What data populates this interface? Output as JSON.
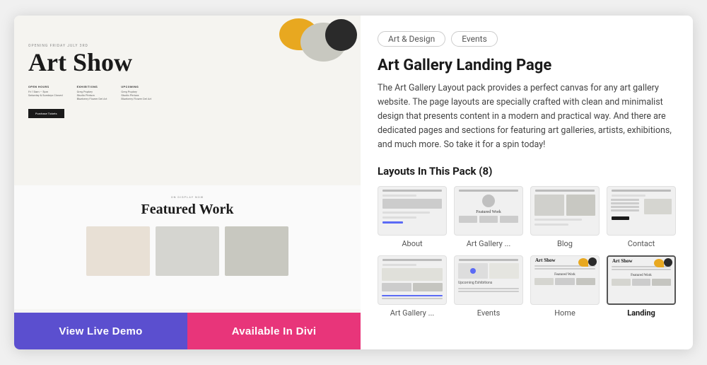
{
  "tags": [
    {
      "label": "Art & Design"
    },
    {
      "label": "Events"
    }
  ],
  "product": {
    "title": "Art Gallery Landing Page",
    "description": "The Art Gallery Layout pack provides a perfect canvas for any art gallery website. The page layouts are specially crafted with clean and minimalist design that presents content in a modern and practical way. And there are dedicated pages and sections for featuring art galleries, artists, exhibitions, and much more. So take it for a spin today!",
    "layouts_heading": "Layouts In This Pack (8)"
  },
  "preview": {
    "small_text": "Opening Friday July 3rd",
    "title": "Art Show",
    "info_cols": [
      {
        "label": "Open Hours",
        "value": "Fri 10am – 5pm\nSaturday & Sundays Closed"
      },
      {
        "label": "Exhibitions",
        "value": "Greg Popkey\nStudio Pintura\nBlueberry Flower Del Art"
      },
      {
        "label": "Upcoming",
        "value": "Greg Popkey\nStudio Pintura\nBlueberry Flower Del Art"
      }
    ],
    "button": "Purchase Tickets",
    "on_display": "On Display Now",
    "featured_title": "Featured Work"
  },
  "actions": {
    "demo_label": "View Live Demo",
    "divi_label": "Available In Divi"
  },
  "layouts": [
    {
      "label": "About",
      "bold": false,
      "type": "about"
    },
    {
      "label": "Art Gallery ...",
      "bold": false,
      "type": "gallery"
    },
    {
      "label": "Blog",
      "bold": false,
      "type": "blog"
    },
    {
      "label": "Contact",
      "bold": false,
      "type": "contact"
    },
    {
      "label": "Art Gallery ...",
      "bold": false,
      "type": "gallery2"
    },
    {
      "label": "Events",
      "bold": false,
      "type": "events"
    },
    {
      "label": "Home",
      "bold": false,
      "type": "home"
    },
    {
      "label": "Landing",
      "bold": true,
      "type": "landing"
    }
  ]
}
